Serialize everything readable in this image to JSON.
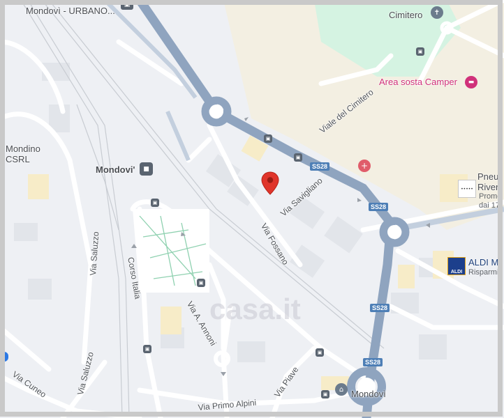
{
  "map": {
    "places": {
      "mondovi_urbano": "Mondovì - URBANO...",
      "cimitero": "Cimitero",
      "area_sosta": "Area sosta Camper",
      "mondino_1": "Mondino",
      "mondino_2": "CSRL",
      "mondovi_station": "Mondovi'",
      "pneu_1": "Pneu",
      "pneu_2": "River",
      "pneu_3": "Promo",
      "pneu_4": "dai 17",
      "aldi_1": "ALDI M",
      "aldi_2": "Risparmi",
      "mondovi_bottom": "Mondovì"
    },
    "roads": {
      "viale_cimitero": "Viale del Cimitero",
      "via_savigliano": "Via Savigliano",
      "via_fossano": "Via Fossano",
      "via_saluzzo_top": "Via Saluzzo",
      "via_saluzzo_bottom": "Via Saluzzo",
      "corso_italia": "Corso Italia",
      "via_annoni": "Via A. Annoni",
      "via_cuneo": "Via Cuneo",
      "via_piave": "Via Piave",
      "via_primo_alpini": "Via Primo Alpini"
    },
    "shields": [
      "SS28",
      "SS28",
      "SS28",
      "SS28"
    ],
    "watermark": "casa.it",
    "aldi_logo": "ALDI",
    "pneu_logo": "•••••",
    "colors": {
      "highway": "#8fa4bf",
      "road": "#ffffff",
      "land": "#eef0f4",
      "sand": "#f3efe2",
      "park": "#d5f3e2",
      "marker": "#e0352b",
      "poi_pink": "#d0317a",
      "shield": "#4e7fb6"
    }
  }
}
